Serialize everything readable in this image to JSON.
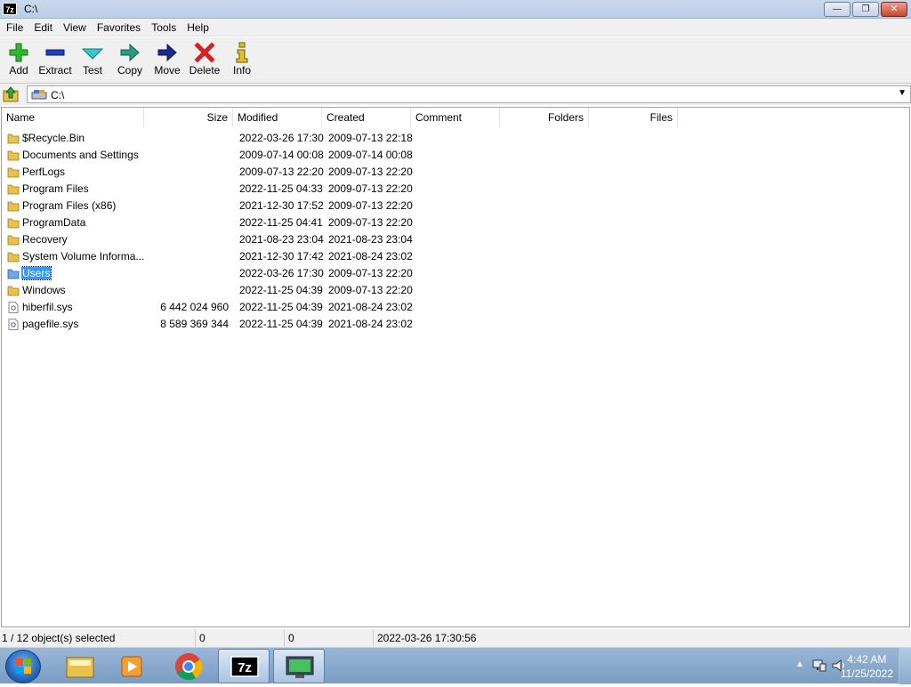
{
  "window": {
    "title": "C:\\",
    "app_icon_text": "7z",
    "minimize": "—",
    "maximize": "❐",
    "close": "✕"
  },
  "menu": [
    "File",
    "Edit",
    "View",
    "Favorites",
    "Tools",
    "Help"
  ],
  "toolbar": {
    "add": "Add",
    "extract": "Extract",
    "test": "Test",
    "copy": "Copy",
    "move": "Move",
    "delete": "Delete",
    "info": "Info"
  },
  "address": {
    "path": "C:\\"
  },
  "columns": {
    "name": "Name",
    "size": "Size",
    "modified": "Modified",
    "created": "Created",
    "comment": "Comment",
    "folders": "Folders",
    "files": "Files"
  },
  "rows": [
    {
      "name": "$Recycle.Bin",
      "size": "",
      "modified": "2022-03-26 17:30",
      "created": "2009-07-13 22:18",
      "type": "folder"
    },
    {
      "name": "Documents and Settings",
      "size": "",
      "modified": "2009-07-14 00:08",
      "created": "2009-07-14 00:08",
      "type": "folder"
    },
    {
      "name": "PerfLogs",
      "size": "",
      "modified": "2009-07-13 22:20",
      "created": "2009-07-13 22:20",
      "type": "folder"
    },
    {
      "name": "Program Files",
      "size": "",
      "modified": "2022-11-25 04:33",
      "created": "2009-07-13 22:20",
      "type": "folder"
    },
    {
      "name": "Program Files (x86)",
      "size": "",
      "modified": "2021-12-30 17:52",
      "created": "2009-07-13 22:20",
      "type": "folder"
    },
    {
      "name": "ProgramData",
      "size": "",
      "modified": "2022-11-25 04:41",
      "created": "2009-07-13 22:20",
      "type": "folder"
    },
    {
      "name": "Recovery",
      "size": "",
      "modified": "2021-08-23 23:04",
      "created": "2021-08-23 23:04",
      "type": "folder"
    },
    {
      "name": "System Volume Informa...",
      "size": "",
      "modified": "2021-12-30 17:42",
      "created": "2021-08-24 23:02",
      "type": "folder"
    },
    {
      "name": "Users",
      "size": "",
      "modified": "2022-03-26 17:30",
      "created": "2009-07-13 22:20",
      "type": "folder",
      "selected": true
    },
    {
      "name": "Windows",
      "size": "",
      "modified": "2022-11-25 04:39",
      "created": "2009-07-13 22:20",
      "type": "folder"
    },
    {
      "name": "hiberfil.sys",
      "size": "6 442 024 960",
      "modified": "2022-11-25 04:39",
      "created": "2021-08-24 23:02",
      "type": "file"
    },
    {
      "name": "pagefile.sys",
      "size": "8 589 369 344",
      "modified": "2022-11-25 04:39",
      "created": "2021-08-24 23:02",
      "type": "file"
    }
  ],
  "status": {
    "selection": "1 / 12 object(s) selected",
    "size": "0",
    "packed": "0",
    "modified": "2022-03-26 17:30:56"
  },
  "taskbar": {
    "apps": [
      "explorer-icon",
      "media-player-icon",
      "chrome-icon",
      "7zip-icon",
      "remote-monitor-icon"
    ],
    "time": "4:42 AM",
    "date": "11/25/2022"
  }
}
